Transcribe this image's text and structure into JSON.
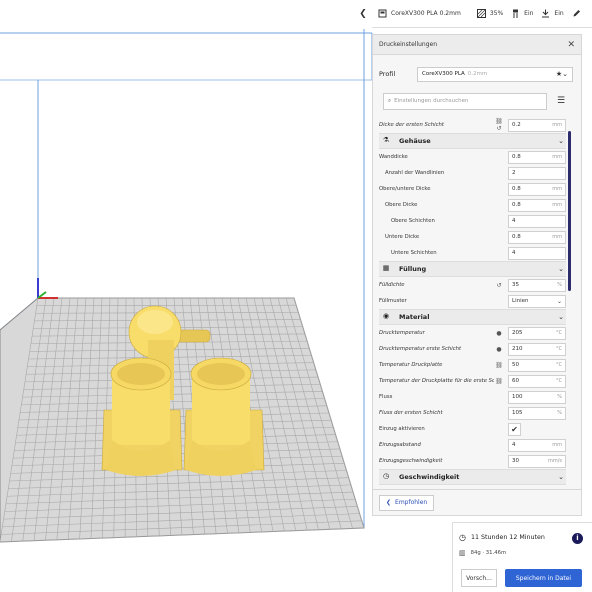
{
  "toolbar": {
    "printer_profile": "CoreXV300 PLA 0.2mm",
    "infill": "35%",
    "support": "Ein",
    "adhesion": "Ein"
  },
  "panel": {
    "title": "Druckeinstellungen",
    "profile_label": "Profil",
    "profile_value": "CoreXV300 PLA",
    "profile_sub": "0.2mm",
    "search_placeholder": "Einstellungen durchsuchen",
    "recommended_button": "Empfohlen"
  },
  "settings": [
    {
      "type": "row",
      "label": "Dicke der ersten Schicht",
      "italic": true,
      "value": "0.2",
      "unit": "mm",
      "icons": "link-reset"
    },
    {
      "type": "cat",
      "label": "Gehäuse",
      "icon": "shell-icon"
    },
    {
      "type": "row",
      "label": "Wanddicke",
      "value": "0.8",
      "unit": "mm"
    },
    {
      "type": "row",
      "label": "Anzahl der Wandlinien",
      "indent": 1,
      "value": "2",
      "unit": ""
    },
    {
      "type": "row",
      "label": "Obere/untere Dicke",
      "value": "0.8",
      "unit": "mm"
    },
    {
      "type": "row",
      "label": "Obere Dicke",
      "indent": 1,
      "value": "0.8",
      "unit": "mm"
    },
    {
      "type": "row",
      "label": "Obere Schichten",
      "indent": 2,
      "value": "4",
      "unit": ""
    },
    {
      "type": "row",
      "label": "Untere Dicke",
      "indent": 1,
      "value": "0.8",
      "unit": "mm"
    },
    {
      "type": "row",
      "label": "Untere Schichten",
      "indent": 2,
      "value": "4",
      "unit": ""
    },
    {
      "type": "cat",
      "label": "Füllung",
      "icon": "infill-icon"
    },
    {
      "type": "row",
      "label": "Fülldichte",
      "italic": true,
      "value": "35",
      "unit": "%",
      "icons": "reset"
    },
    {
      "type": "row",
      "label": "Füllmuster",
      "value": "Linien",
      "unit": "⌄",
      "select": true
    },
    {
      "type": "cat",
      "label": "Material",
      "icon": "material-icon"
    },
    {
      "type": "row",
      "label": "Drucktemperatur",
      "italic": true,
      "value": "205",
      "unit": "°C",
      "icons": "extruder"
    },
    {
      "type": "row",
      "label": "Drucktemperatur erste Schicht",
      "italic": true,
      "value": "210",
      "unit": "°C",
      "icons": "extruder"
    },
    {
      "type": "row",
      "label": "Temperatur Druckplatte",
      "italic": true,
      "value": "50",
      "unit": "°C",
      "icons": "link"
    },
    {
      "type": "row",
      "label": "Temperatur der Druckplatte für die erste Schicht",
      "italic": true,
      "value": "60",
      "unit": "°C",
      "icons": "link"
    },
    {
      "type": "row",
      "label": "Fluss",
      "value": "100",
      "unit": "%"
    },
    {
      "type": "row",
      "label": "Fluss der ersten Schicht",
      "italic": true,
      "value": "105",
      "unit": "%"
    },
    {
      "type": "check",
      "label": "Einzug aktivieren",
      "checked": "✔"
    },
    {
      "type": "row",
      "label": "Einzugsabstand",
      "italic": true,
      "value": "4",
      "unit": "mm"
    },
    {
      "type": "row",
      "label": "Einzugsgeschwindigkeit",
      "italic": true,
      "value": "30",
      "unit": "mm/s"
    },
    {
      "type": "cat",
      "label": "Geschwindigkeit",
      "icon": "speed-icon"
    }
  ],
  "estimate": {
    "time": "11 Stunden 12 Minuten",
    "material": "84g · 31.46m",
    "preview_button": "Vorsch...",
    "save_button": "Speichern in Datei"
  },
  "colors": {
    "accent": "#2f64d5",
    "model": "#f8dd6b",
    "scrollbar": "#2d2d6e"
  }
}
